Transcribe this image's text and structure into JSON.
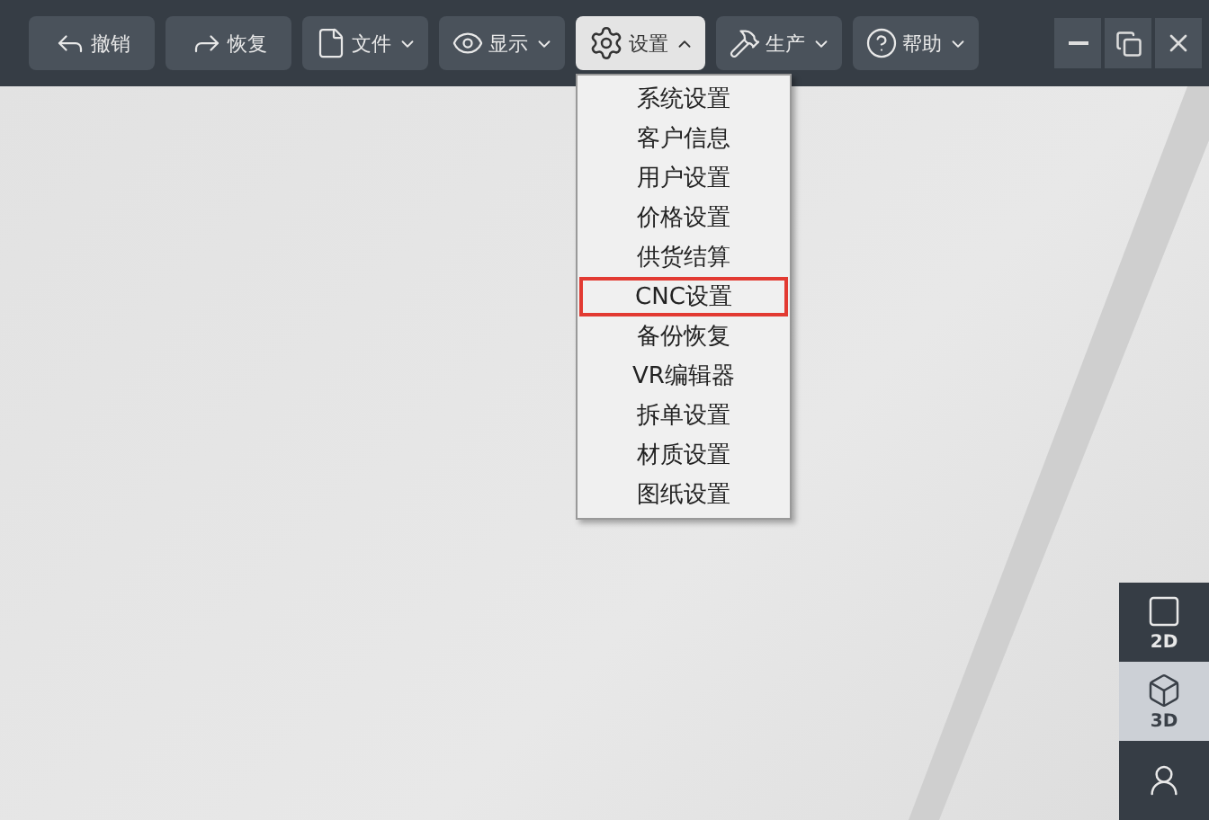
{
  "toolbar": [
    {
      "label": "撤销",
      "kind": "action",
      "expanded": false
    },
    {
      "label": "恢复",
      "kind": "action",
      "expanded": false
    },
    {
      "label": "文件",
      "kind": "menu",
      "expanded": false
    },
    {
      "label": "显示",
      "kind": "menu",
      "expanded": false
    },
    {
      "label": "设置",
      "kind": "menu",
      "expanded": true
    },
    {
      "label": "生产",
      "kind": "menu",
      "expanded": false
    },
    {
      "label": "帮助",
      "kind": "menu",
      "expanded": false
    }
  ],
  "settings_menu": [
    {
      "label": "系统设置",
      "selected": false
    },
    {
      "label": "客户信息",
      "selected": false
    },
    {
      "label": "用户设置",
      "selected": false
    },
    {
      "label": "价格设置",
      "selected": false
    },
    {
      "label": "供货结算",
      "selected": false
    },
    {
      "label": "CNC设置",
      "selected": true
    },
    {
      "label": "备份恢复",
      "selected": false
    },
    {
      "label": "VR编辑器",
      "selected": false
    },
    {
      "label": "拆单设置",
      "selected": false
    },
    {
      "label": "材质设置",
      "selected": false
    },
    {
      "label": "图纸设置",
      "selected": false
    }
  ],
  "view_switcher": [
    {
      "kind": "flat",
      "label": "2D",
      "selected": false
    },
    {
      "kind": "cube",
      "label": "3D",
      "selected": true
    },
    {
      "kind": "person",
      "selected": false
    }
  ]
}
